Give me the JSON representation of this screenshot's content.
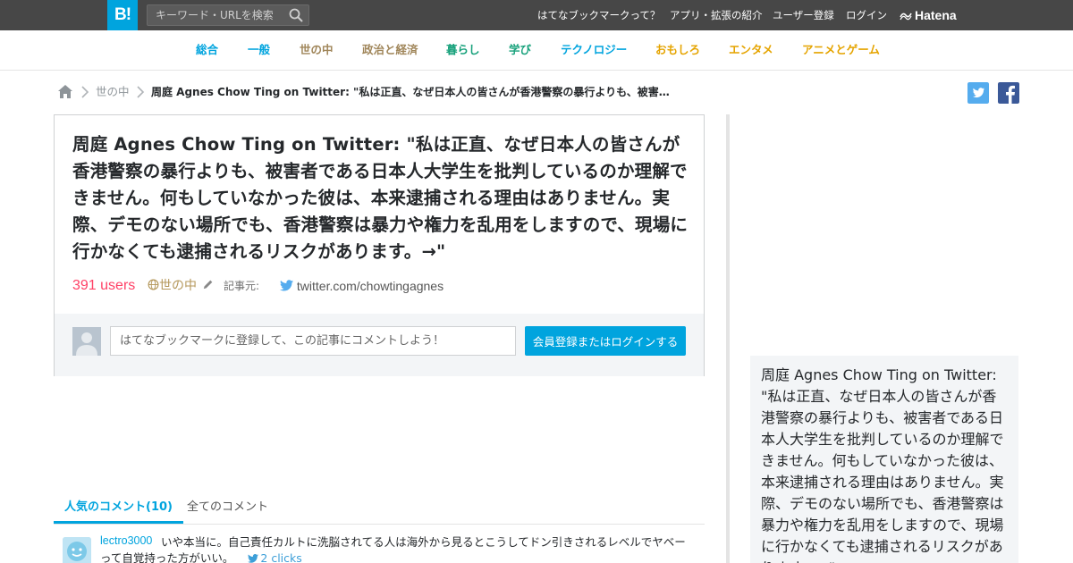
{
  "header": {
    "logo": "B!",
    "search_placeholder": "キーワード・URLを検索",
    "nav": [
      "はてなブックマークって？",
      "アプリ・拡張の紹介",
      "ユーザー登録",
      "ログイン"
    ],
    "brand": "Hatena"
  },
  "categories": [
    {
      "label": "総合",
      "color": "#00a4de"
    },
    {
      "label": "一般",
      "color": "#00a4de"
    },
    {
      "label": "世の中",
      "color": "#a0865a"
    },
    {
      "label": "政治と経済",
      "color": "#a0865a"
    },
    {
      "label": "暮らし",
      "color": "#17a17b"
    },
    {
      "label": "学び",
      "color": "#17a17b"
    },
    {
      "label": "テクノロジー",
      "color": "#00a4de"
    },
    {
      "label": "おもしろ",
      "color": "#e5a400"
    },
    {
      "label": "エンタメ",
      "color": "#e5a400"
    },
    {
      "label": "アニメとゲーム",
      "color": "#e5a400"
    }
  ],
  "breadcrumb": {
    "category": "世の中",
    "current": "周庭 Agnes Chow Ting  on Twitter: \"私は正直、なぜ日本人の皆さんが香港警察の暴行よりも、被害者である日本人大学生を批判しているのか理解できません。"
  },
  "entry": {
    "title": "周庭 Agnes Chow Ting  on Twitter: \"私は正直、なぜ日本人の皆さんが香港警察の暴行よりも、被害者である日本人大学生を批判しているのか理解できません。何もしていなかった彼は、本来逮捕される理由はありません。実際、デモのない場所でも、香港警察は暴力や権力を乱用をしますので、現場に行かなくても逮捕されるリスクがあります。→\"",
    "users": "391 users",
    "category": "世の中",
    "source_label": "記事元:",
    "source_domain": "twitter.com/chowtingagnes",
    "comment_placeholder": "はてなブックマークに登録して、この記事にコメントしよう！",
    "login_button": "会員登録またはログインする"
  },
  "tabs": {
    "popular": "人気のコメント(10)",
    "all": "全てのコメント"
  },
  "comments": [
    {
      "user": "lectro3000",
      "text": "いや本当に。自己責任カルトに洗脳されてる人は海外から見るとこうしてドン引きされるレベルでヤベーって自覚持った方がいい。",
      "clicks": "2 clicks"
    }
  ],
  "sidebar": {
    "text": "周庭 Agnes Chow Ting  on Twitter: \"私は正直、なぜ日本人の皆さんが香港警察の暴行よりも、被害者である日本人大学生を批判しているのか理解できません。何もしていなかった彼は、本来逮捕される理由はありません。実際、デモのない場所でも、香港警察は暴力や権力を乱用をしますので、現場に行かなくても逮捕されるリスクがあります。→\""
  },
  "colors": {
    "accent": "#00a4de",
    "users": "#ff4166",
    "topbar": "#474747",
    "twitter": "#55acee",
    "facebook": "#3b5998"
  }
}
